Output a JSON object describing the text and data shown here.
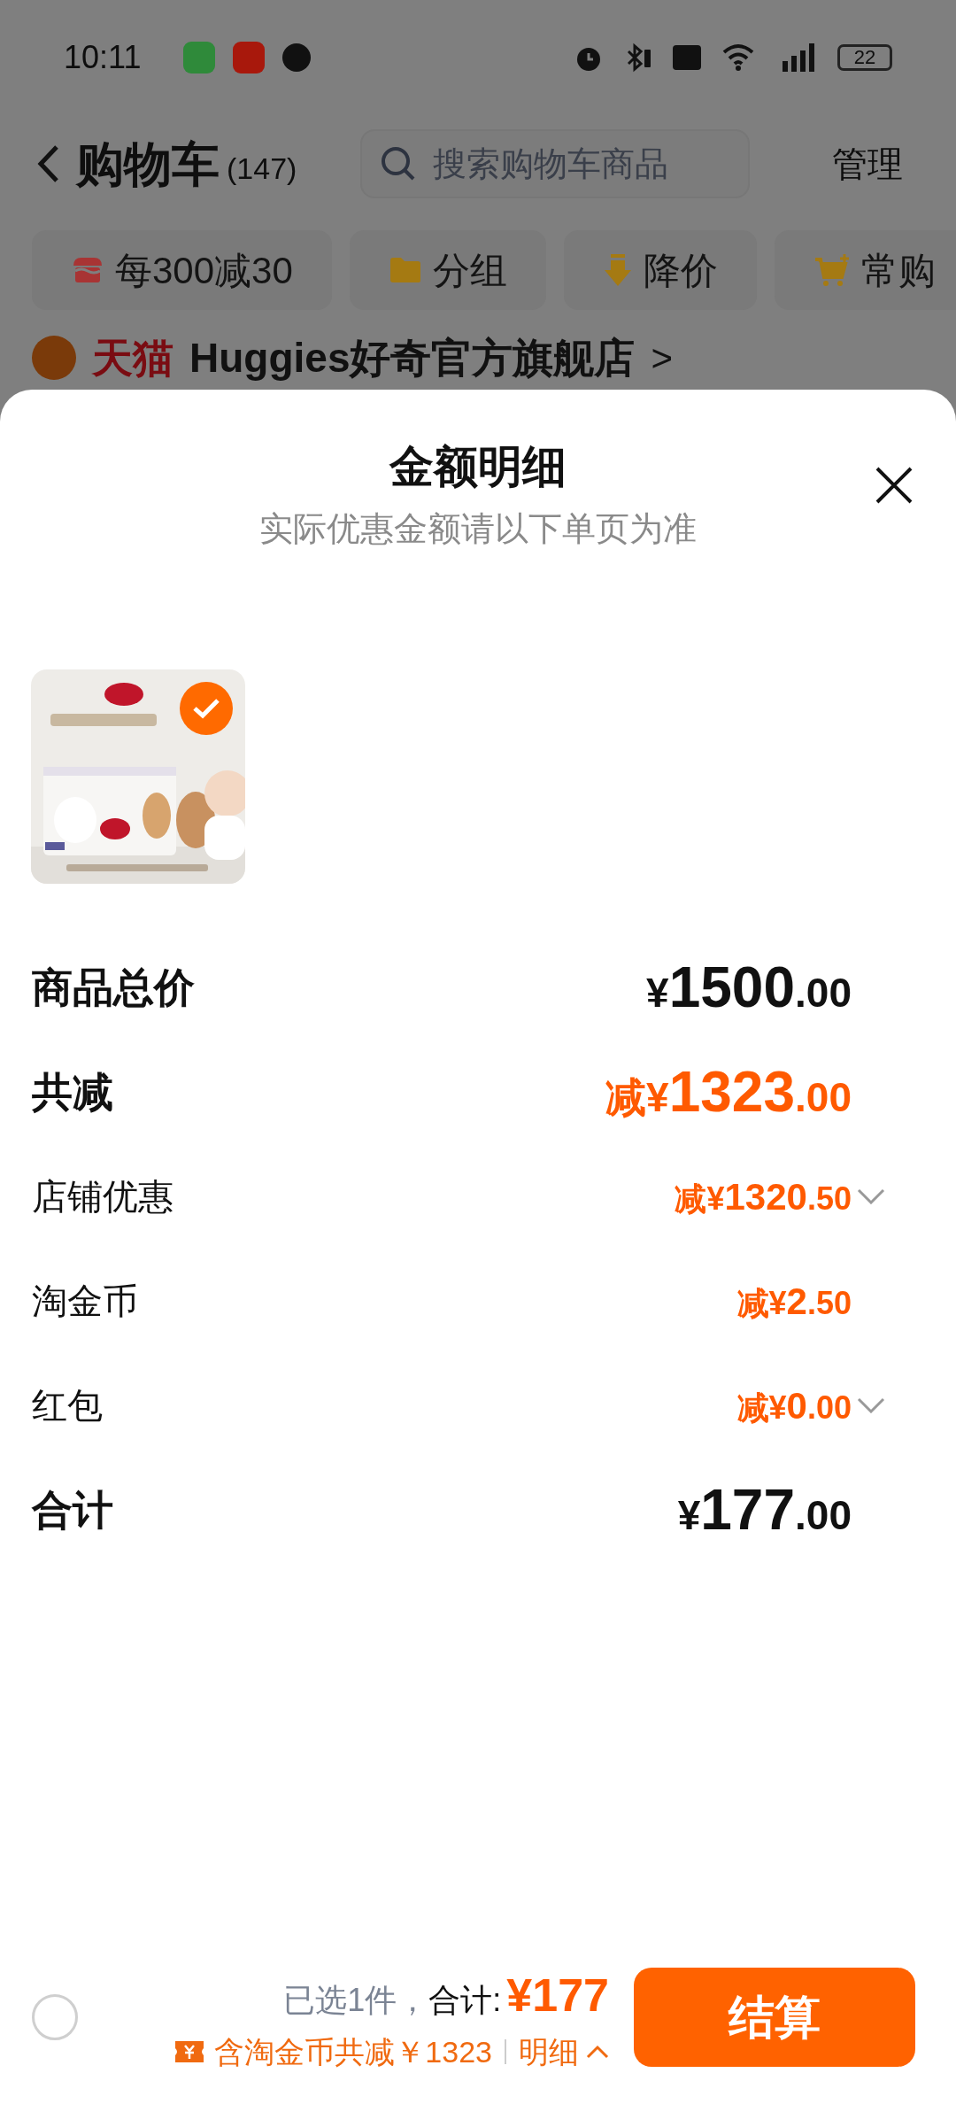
{
  "status_bar": {
    "time": "10:11",
    "battery": "22"
  },
  "header": {
    "title": "购物车",
    "count": "(147)",
    "search": {
      "placeholder": "搜索购物车商品"
    },
    "manage": "管理"
  },
  "chips": [
    {
      "label": "每300减30",
      "kind": "store"
    },
    {
      "label": "分组",
      "kind": "folder"
    },
    {
      "label": "降价",
      "kind": "down"
    },
    {
      "label": "常购",
      "kind": "cart"
    }
  ],
  "shop": {
    "brand": "天猫",
    "name": "Huggies好奇官方旗舰店",
    "arrow": ">"
  },
  "sheet": {
    "title": "金额明细",
    "subtitle": "实际优惠金额请以下单页为准",
    "products": [
      {
        "kind": "picture",
        "selected": true
      }
    ],
    "rows": [
      {
        "kind": "main",
        "label": "商品总价",
        "prefix": "¥",
        "integer": "1500",
        "decimal": ".00",
        "color": "#111111",
        "expandable": false
      },
      {
        "kind": "main",
        "label": "共减",
        "prefix": "减¥",
        "integer": "1323",
        "decimal": ".00",
        "color": "#ff5a00",
        "expandable": false
      },
      {
        "kind": "sub",
        "label": "店铺优惠",
        "prefix": "减¥",
        "integer": "1320",
        "decimal": ".50",
        "color": "#ff5a00",
        "expandable": true
      },
      {
        "kind": "sub",
        "label": "淘金币",
        "prefix": "减¥",
        "integer": "2",
        "decimal": ".50",
        "color": "#ff5a00",
        "expandable": false
      },
      {
        "kind": "sub",
        "label": "红包",
        "prefix": "减¥",
        "integer": "0",
        "decimal": ".00",
        "color": "#ff5a00",
        "expandable": true
      },
      {
        "kind": "main",
        "label": "合计",
        "prefix": "¥",
        "integer": "177",
        "decimal": ".00",
        "color": "#111111",
        "expandable": false
      }
    ]
  },
  "bottom_bar": {
    "select_all_checked": false,
    "selected_count": "已选1件，",
    "total_label": "合计:",
    "total": "¥177",
    "savings": "含淘金币共减￥1323",
    "details": "明细",
    "details_expanded": true,
    "checkout": "结算"
  }
}
